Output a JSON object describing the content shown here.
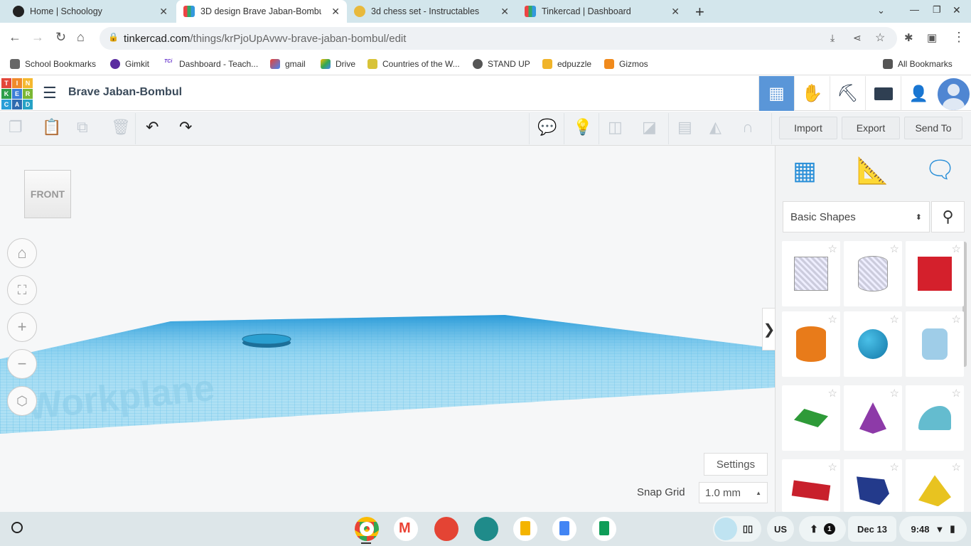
{
  "browser": {
    "tabs": [
      {
        "title": "Home | Schoology",
        "icon": "schoology-icon"
      },
      {
        "title": "3D design Brave Jaban-Bombul",
        "icon": "tinkercad-icon",
        "active": true
      },
      {
        "title": "3d chess set - Instructables",
        "icon": "instructables-icon"
      },
      {
        "title": "Tinkercad | Dashboard",
        "icon": "tinkercad-icon"
      }
    ],
    "url_host": "tinkercad.com",
    "url_path": "/things/krPjoUpAvwv-brave-jaban-bombul/edit",
    "bookmarks": [
      "School Bookmarks",
      "Gimkit",
      "Dashboard - Teach...",
      "gmail",
      "Drive",
      "Countries of the W...",
      "STAND UP",
      "edpuzzle",
      "Gizmos"
    ],
    "all_bookmarks": "All Bookmarks"
  },
  "app": {
    "logo_letters": [
      "T",
      "I",
      "N",
      "K",
      "E",
      "R",
      "C",
      "A",
      "D"
    ],
    "design_title": "Brave Jaban-Bombul",
    "toolbar": {
      "import": "Import",
      "export": "Export",
      "send_to": "Send To"
    },
    "viewcube_label": "FRONT",
    "workplane_label": "Workplane",
    "settings": "Settings",
    "snap_grid_label": "Snap Grid",
    "snap_grid_value": "1.0 mm",
    "shapes_dropdown": "Basic Shapes",
    "shapes": [
      "Box",
      "Cylinder",
      "Box",
      "Cylinder",
      "Sphere",
      "Scribble",
      "Roof",
      "Cone",
      "Round Roof",
      "Text",
      "Polygon",
      "Pyramid"
    ],
    "colors": {
      "accent": "#5a96d8",
      "workplane": "#5bc4ea"
    }
  },
  "taskbar": {
    "ime": "US",
    "notifications": "1",
    "date": "Dec 13",
    "time": "9:48"
  }
}
